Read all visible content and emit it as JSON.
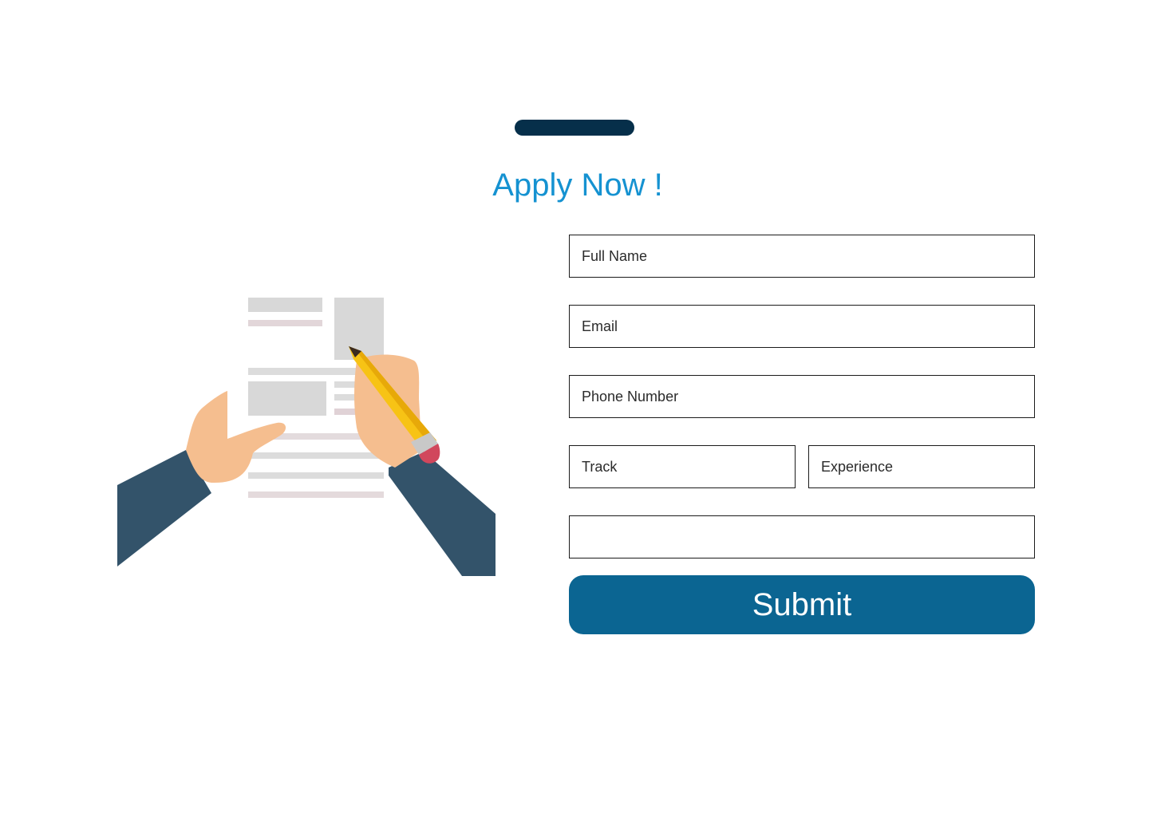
{
  "header": {
    "title": "Apply Now !",
    "accent_color": "#1592d1",
    "pill_color": "#062f4a"
  },
  "illustration": {
    "icon": "hands-writing-document-illustration"
  },
  "form": {
    "full_name": {
      "placeholder": "Full Name",
      "value": ""
    },
    "email": {
      "placeholder": "Email",
      "value": ""
    },
    "phone": {
      "placeholder": "Phone Number",
      "value": ""
    },
    "track": {
      "placeholder": "Track",
      "value": ""
    },
    "experience": {
      "placeholder": "Experience",
      "value": ""
    },
    "extra": {
      "placeholder": "",
      "value": ""
    },
    "submit_label": "Submit",
    "submit_color": "#0b6592"
  }
}
